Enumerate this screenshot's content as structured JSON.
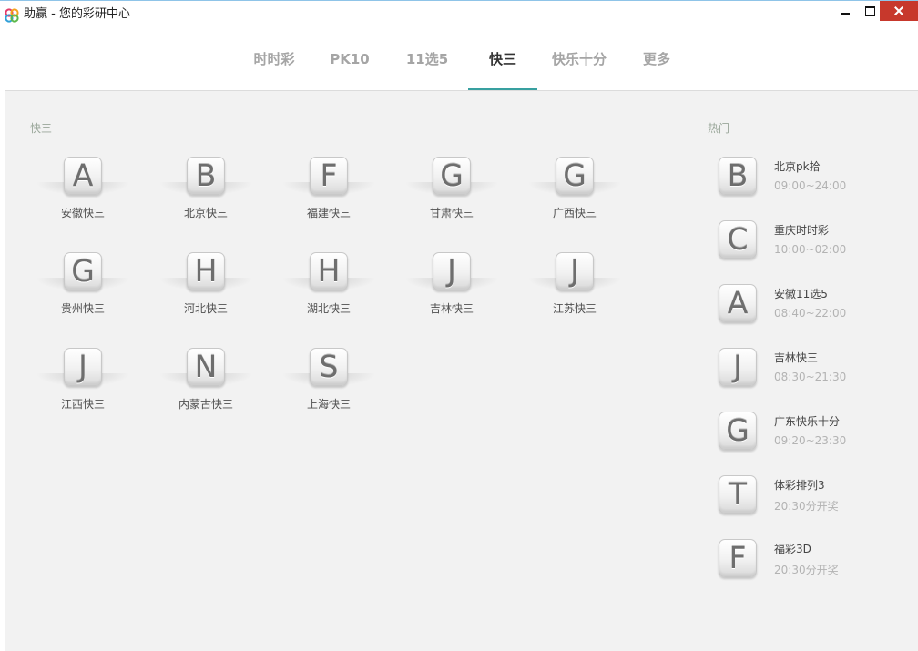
{
  "window": {
    "title": "助赢 - 您的彩研中心"
  },
  "nav": {
    "tabs": [
      {
        "label": "时时彩"
      },
      {
        "label": "PK10"
      },
      {
        "label": "11选5"
      },
      {
        "label": "快三"
      },
      {
        "label": "快乐十分"
      },
      {
        "label": "更多"
      }
    ],
    "active_index": 3
  },
  "main": {
    "section_title": "快三",
    "tiles": [
      {
        "letter": "A",
        "label": "安徽快三"
      },
      {
        "letter": "B",
        "label": "北京快三"
      },
      {
        "letter": "F",
        "label": "福建快三"
      },
      {
        "letter": "G",
        "label": "甘肃快三"
      },
      {
        "letter": "G",
        "label": "广西快三"
      },
      {
        "letter": "G",
        "label": "贵州快三"
      },
      {
        "letter": "H",
        "label": "河北快三"
      },
      {
        "letter": "H",
        "label": "湖北快三"
      },
      {
        "letter": "J",
        "label": "吉林快三"
      },
      {
        "letter": "J",
        "label": "江苏快三"
      },
      {
        "letter": "J",
        "label": "江西快三"
      },
      {
        "letter": "N",
        "label": "内蒙古快三"
      },
      {
        "letter": "S",
        "label": "上海快三"
      }
    ]
  },
  "hot": {
    "title": "热门",
    "items": [
      {
        "letter": "B",
        "name": "北京pk拾",
        "time": "09:00~24:00"
      },
      {
        "letter": "C",
        "name": "重庆时时彩",
        "time": "10:00~02:00"
      },
      {
        "letter": "A",
        "name": "安徽11选5",
        "time": "08:40~22:00"
      },
      {
        "letter": "J",
        "name": "吉林快三",
        "time": "08:30~21:30"
      },
      {
        "letter": "G",
        "name": "广东快乐十分",
        "time": "09:20~23:30"
      },
      {
        "letter": "T",
        "name": "体彩排列3",
        "time": "20:30分开奖"
      },
      {
        "letter": "F",
        "name": "福彩3D",
        "time": "20:30分开奖"
      }
    ]
  },
  "colors": {
    "accent": "#38a0a0",
    "close_button": "#c7382c"
  }
}
